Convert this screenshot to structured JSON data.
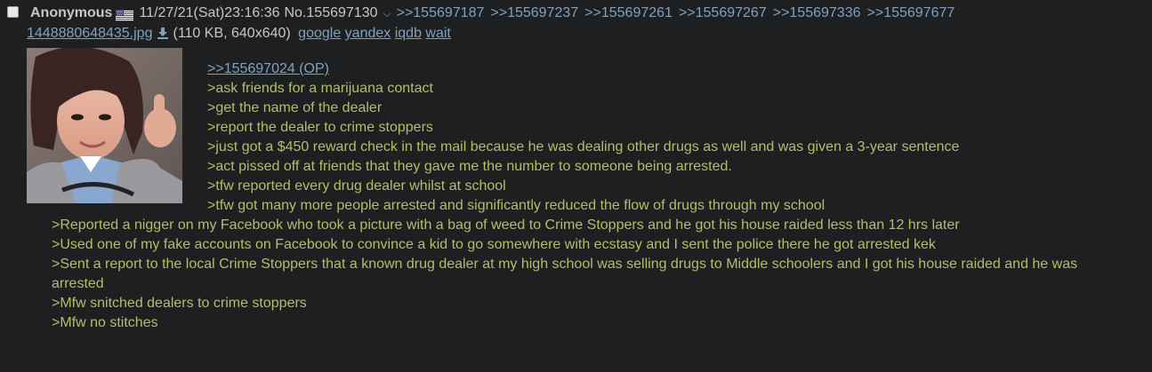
{
  "post": {
    "name": "Anonymous",
    "flag_country": "United States",
    "datetime": "11/27/21(Sat)23:16:36",
    "number": "No.155697130",
    "menu_arrow": "⌵",
    "backlinks": [
      ">>155697187",
      ">>155697237",
      ">>155697261",
      ">>155697267",
      ">>155697336",
      ">>155697677"
    ]
  },
  "file": {
    "filename": "1448880648435.jpg",
    "meta": "(110 KB, 640x640)",
    "search_links": [
      "google",
      "yandex",
      "iqdb",
      "wait"
    ]
  },
  "message": {
    "op_link": ">>155697024 (OP)",
    "lines_beside_image": [
      ">ask friends for a marijuana contact",
      ">get the name of the dealer",
      ">report the dealer to crime stoppers",
      ">just got a $450 reward check in the mail because he was dealing other drugs as well and was given a 3-year sentence",
      ">act pissed off at friends that they gave me the number to someone being arrested.",
      ">tfw reported every drug dealer whilst at school",
      ">tfw got many more people arrested and significantly reduced the flow of drugs through my school"
    ],
    "lines_below_image": [
      ">Reported a nigger on my Facebook who took a picture with a bag of weed to Crime Stoppers and he got his house raided less than 12 hrs later",
      ">Used one of my fake accounts on Facebook to convince a kid to go somewhere with ecstasy and I sent the police there he got arrested kek",
      ">Sent a report to the local Crime Stoppers that a known drug dealer at my high school was selling drugs to Middle schoolers and I got his house raided and he was arrested",
      ">Mfw snitched dealers to crime stoppers",
      ">Mfw no stitches"
    ]
  },
  "colors": {
    "background": "#1d1f21",
    "text": "#c5c8c6",
    "greentext": "#b5bd68",
    "link": "#81a2be"
  }
}
